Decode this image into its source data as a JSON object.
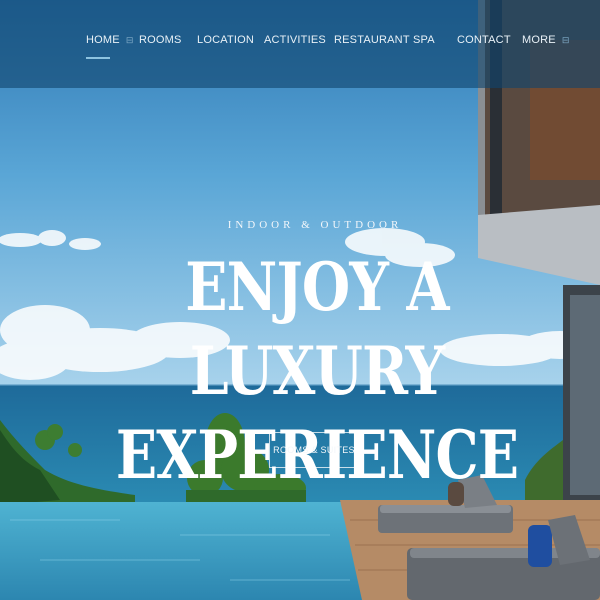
{
  "nav": {
    "items": [
      {
        "label": "HOME",
        "active": true,
        "suffix": "⊟"
      },
      {
        "label": "ROOMS"
      },
      {
        "label": "LOCATION"
      },
      {
        "label": "ACTIVITIES"
      },
      {
        "label": "RESTAURANT"
      },
      {
        "label": "SPA"
      },
      {
        "label": "CONTACT"
      },
      {
        "label": "MORE",
        "suffix": "⊟"
      }
    ]
  },
  "hero": {
    "eyebrow": "INDOOR & OUTDOOR",
    "headline_line1": "ENJOY A LUXURY",
    "headline_line2": "EXPERIENCE",
    "cta_label": "ROOMS & SUITES"
  },
  "colors": {
    "nav_overlay": "#10466e",
    "sky": "#3f8fc9",
    "sea": "#1d6f9e",
    "pool": "#3fa3c7",
    "accent_underline": "#8dc3e0"
  }
}
